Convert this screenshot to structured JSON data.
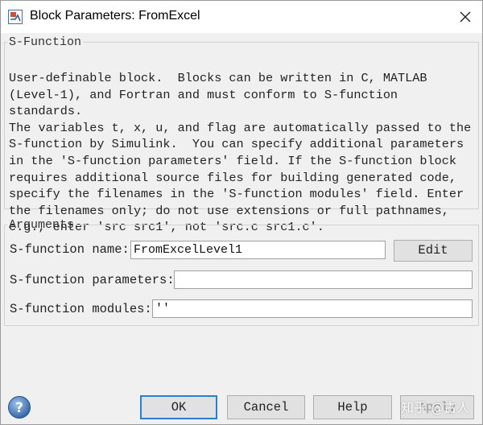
{
  "window": {
    "title": "Block Parameters: FromExcel",
    "app_icon": "simulink-block-icon",
    "close_icon": "close-icon"
  },
  "sfunction_group": {
    "legend": "S-Function",
    "description": "User-definable block.  Blocks can be written in C, MATLAB\n(Level-1), and Fortran and must conform to S-function standards.\nThe variables t, x, u, and flag are automatically passed to the\nS-function by Simulink.  You can specify additional parameters\nin the 'S-function parameters' field. If the S-function block\nrequires additional source files for building generated code,\nspecify the filenames in the 'S-function modules' field. Enter\nthe filenames only; do not use extensions or full pathnames,\ne.g., enter 'src src1', not 'src.c src1.c'."
  },
  "arguments_group": {
    "legend": "Arguments",
    "name_label": "S-function name:",
    "name_value": "FromExcelLevel1",
    "edit_label": "Edit",
    "parameters_label": "S-function parameters:",
    "parameters_value": "",
    "modules_label": "S-function modules:",
    "modules_value": "''"
  },
  "buttons": {
    "ok": "OK",
    "cancel": "Cancel",
    "help": "Help",
    "apply": "Apply"
  },
  "help_icon": "help-icon",
  "watermark": "知乎 @古人"
}
